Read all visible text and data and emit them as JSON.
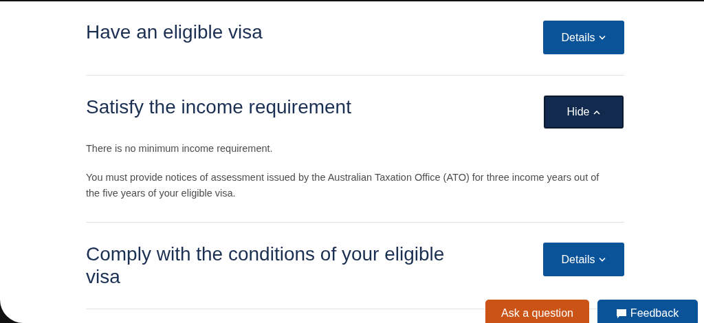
{
  "sections": [
    {
      "title": "Have an eligible visa",
      "expanded": false,
      "button": "Details"
    },
    {
      "title": "Satisfy the income requirement",
      "expanded": true,
      "button": "Hide",
      "body": [
        "There is no minimum income requirement.",
        "You must provide notices of assessment issued by the Australian Taxation Office (ATO) for three income years out of the five years of your eligible visa."
      ]
    },
    {
      "title": "Comply with the conditions of your eligible visa",
      "expanded": false,
      "button": "Details"
    }
  ],
  "floating_buttons": [
    {
      "label": "Ask a question",
      "kind": "question"
    },
    {
      "label": "Feedback",
      "kind": "feedback"
    }
  ]
}
